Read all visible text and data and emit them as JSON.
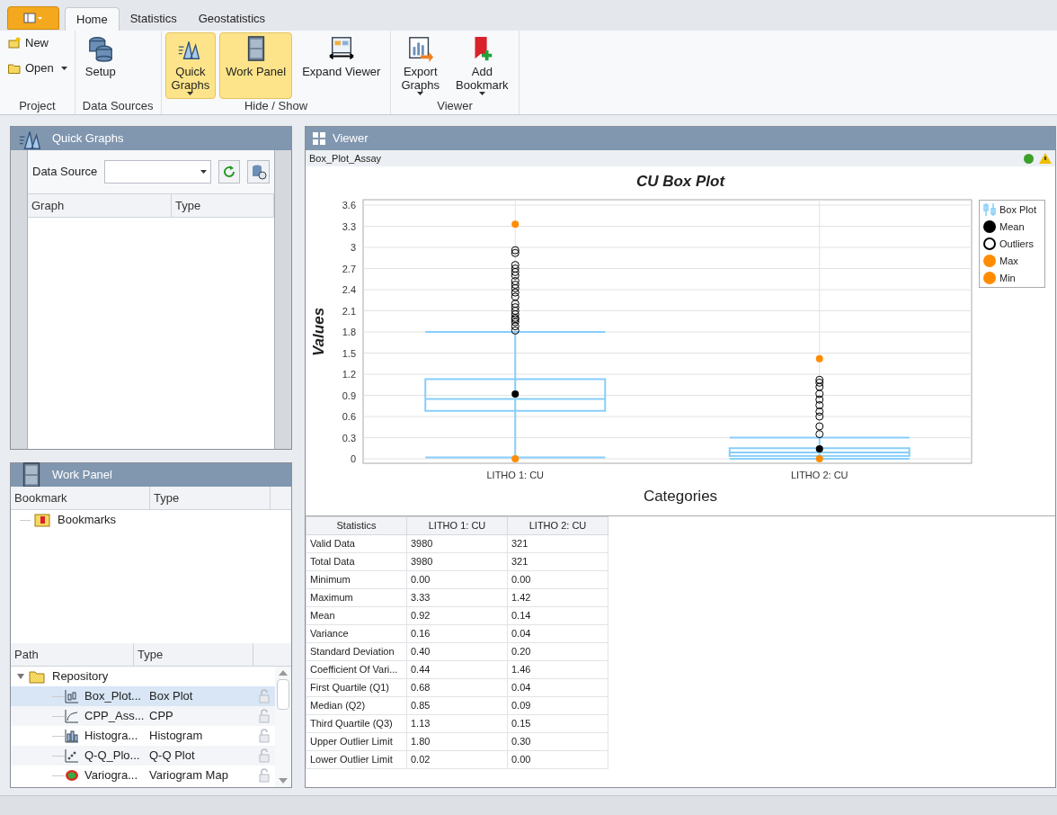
{
  "ribbon": {
    "tabs": [
      {
        "label": "Home",
        "selected": true
      },
      {
        "label": "Statistics",
        "selected": false
      },
      {
        "label": "Geostatistics",
        "selected": false
      }
    ],
    "groups": [
      {
        "label": "Project",
        "buttons": [
          {
            "lines": [
              "New"
            ],
            "kind": "small",
            "dropdown": false
          },
          {
            "lines": [
              "Open"
            ],
            "kind": "small",
            "dropdown": true
          }
        ]
      },
      {
        "label": "Data Sources",
        "buttons": [
          {
            "lines": [
              "Setup"
            ],
            "kind": "large",
            "dropdown": false
          }
        ]
      },
      {
        "label": "Hide / Show",
        "buttons": [
          {
            "lines": [
              "Quick",
              "Graphs"
            ],
            "kind": "toggle",
            "dropdown": true,
            "selected": true
          },
          {
            "lines": [
              "Work Panel"
            ],
            "kind": "toggle",
            "dropdown": false,
            "selected": true
          },
          {
            "lines": [
              "Expand Viewer"
            ],
            "kind": "toggle",
            "dropdown": false,
            "selected": false
          }
        ]
      },
      {
        "label": "Viewer",
        "buttons": [
          {
            "lines": [
              "Export",
              "Graphs"
            ],
            "kind": "large",
            "dropdown": true
          },
          {
            "lines": [
              "Add",
              "Bookmark"
            ],
            "kind": "large",
            "dropdown": true
          }
        ]
      }
    ]
  },
  "quick_graphs": {
    "title": "Quick Graphs",
    "data_source_label": "Data Source",
    "columns": [
      "Graph",
      "Type"
    ]
  },
  "work_panel": {
    "title": "Work Panel",
    "bookmark_columns": [
      "Bookmark",
      "Type"
    ],
    "bookmarks": [
      {
        "label": "Bookmarks"
      }
    ],
    "path_columns": [
      "Path",
      "Type"
    ],
    "repository": {
      "label": "Repository",
      "expanded": true,
      "children": [
        {
          "name": "Box_Plot...",
          "type": "Box Plot",
          "kind": "boxplot",
          "selected": true
        },
        {
          "name": "CPP_Ass...",
          "type": "CPP",
          "kind": "cpp",
          "selected": false
        },
        {
          "name": "Histogra...",
          "type": "Histogram",
          "kind": "histogram",
          "selected": false
        },
        {
          "name": "Q-Q_Plo...",
          "type": "Q-Q Plot",
          "kind": "qq",
          "selected": false
        },
        {
          "name": "Variogra...",
          "type": "Variogram Map",
          "kind": "variogram",
          "selected": false
        }
      ]
    }
  },
  "viewer": {
    "title": "Viewer",
    "document": "Box_Plot_Assay",
    "chart_data": {
      "type": "scatter",
      "title": "CU Box Plot",
      "xlabel": "Categories",
      "ylabel": "Values",
      "categories": [
        "LITHO 1: CU",
        "LITHO 2: CU"
      ],
      "ylim": [
        0,
        3.6
      ],
      "grid": true,
      "yticks": [
        {
          "value": 0,
          "label": "0"
        },
        {
          "value": 0.3,
          "label": "0.3"
        },
        {
          "value": 0.6,
          "label": "0.6"
        },
        {
          "value": 0.9,
          "label": "0.9"
        },
        {
          "value": 1.2,
          "label": "1.2"
        },
        {
          "value": 1.5,
          "label": "1.5"
        },
        {
          "value": 1.8,
          "label": "1.8"
        },
        {
          "value": 2.1,
          "label": "2.1"
        },
        {
          "value": 2.4,
          "label": "2.4"
        },
        {
          "value": 2.7,
          "label": "2.7"
        },
        {
          "value": 3,
          "label": "3"
        },
        {
          "value": 3.3,
          "label": "3.3"
        },
        {
          "value": 3.6,
          "label": "3.6"
        }
      ],
      "series": [
        {
          "name": "Mean",
          "color": "#000000",
          "x": [
            "LITHO 1: CU",
            "LITHO 2: CU"
          ],
          "values": [
            0.92,
            0.14
          ]
        },
        {
          "name": "Outliers",
          "color": "#000000",
          "x": [
            "LITHO 1: CU",
            "LITHO 1: CU",
            "LITHO 1: CU",
            "LITHO 1: CU",
            "LITHO 1: CU",
            "LITHO 1: CU",
            "LITHO 1: CU",
            "LITHO 1: CU",
            "LITHO 1: CU",
            "LITHO 1: CU",
            "LITHO 1: CU",
            "LITHO 1: CU",
            "LITHO 1: CU",
            "LITHO 1: CU",
            "LITHO 1: CU",
            "LITHO 1: CU",
            "LITHO 1: CU",
            "LITHO 1: CU",
            "LITHO 1: CU",
            "LITHO 1: CU",
            "LITHO 2: CU",
            "LITHO 2: CU",
            "LITHO 2: CU",
            "LITHO 2: CU",
            "LITHO 2: CU",
            "LITHO 2: CU",
            "LITHO 2: CU",
            "LITHO 2: CU",
            "LITHO 2: CU",
            "LITHO 2: CU"
          ],
          "values": [
            1.82,
            1.88,
            1.94,
            2.0,
            2.05,
            2.1,
            2.15,
            2.2,
            2.3,
            2.36,
            2.42,
            2.47,
            2.52,
            2.6,
            2.65,
            2.7,
            2.75,
            2.92,
            2.96,
            1.98,
            0.35,
            0.46,
            0.6,
            0.67,
            0.76,
            0.84,
            0.92,
            1.02,
            1.08,
            1.12
          ]
        },
        {
          "name": "Max",
          "color": "#ff8c00",
          "x": [
            "LITHO 1: CU",
            "LITHO 2: CU"
          ],
          "values": [
            3.33,
            1.42
          ]
        },
        {
          "name": "Min",
          "color": "#ff8c00",
          "x": [
            "LITHO 1: CU",
            "LITHO 2: CU"
          ],
          "values": [
            0,
            0
          ]
        }
      ]
    },
    "box_plot": {
      "label": "Box Plot",
      "color": "#87cefa"
    },
    "series_markers": [
      {
        "kind": "dot"
      },
      {
        "kind": "ring"
      },
      {
        "kind": "dot"
      },
      {
        "kind": "dot"
      }
    ],
    "table": {
      "columns": [
        "Statistics",
        "LITHO 1: CU",
        "LITHO 2: CU"
      ],
      "rows": [
        [
          "Valid Data",
          "3980",
          "321"
        ],
        [
          "Total Data",
          "3980",
          "321"
        ],
        [
          "Minimum",
          "0.00",
          "0.00"
        ],
        [
          "Maximum",
          "3.33",
          "1.42"
        ],
        [
          "Mean",
          "0.92",
          "0.14"
        ],
        [
          "Variance",
          "0.16",
          "0.04"
        ],
        [
          "Standard Deviation",
          "0.40",
          "0.20"
        ],
        [
          "Coefficient Of Vari...",
          "0.44",
          "1.46"
        ],
        [
          "First Quartile (Q1)",
          "0.68",
          "0.04"
        ],
        [
          "Median (Q2)",
          "0.85",
          "0.09"
        ],
        [
          "Third Quartile (Q3)",
          "1.13",
          "0.15"
        ],
        [
          "Upper Outlier Limit",
          "1.80",
          "0.30"
        ],
        [
          "Lower Outlier Limit",
          "0.02",
          "0.00"
        ]
      ]
    }
  }
}
